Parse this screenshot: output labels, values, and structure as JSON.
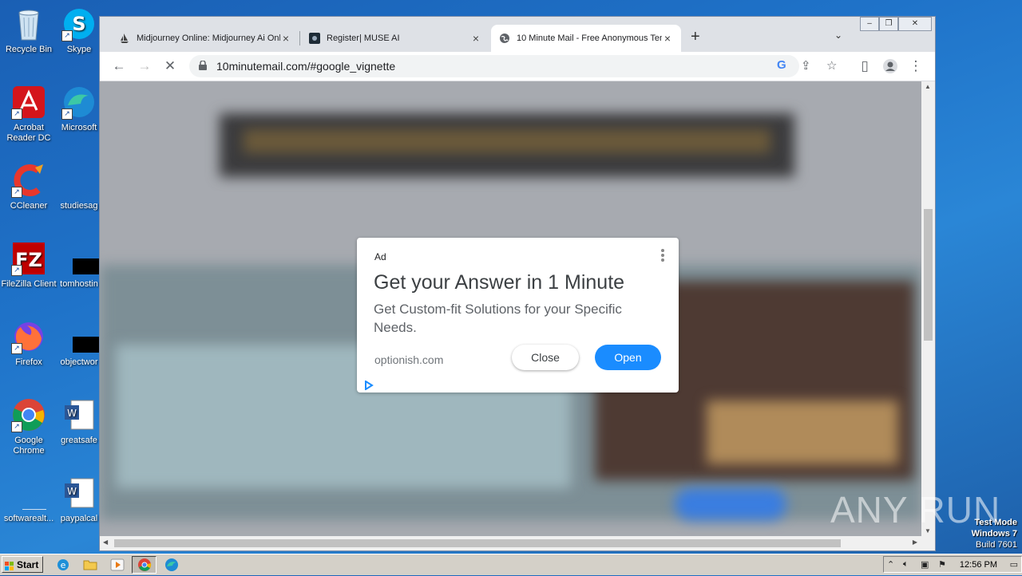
{
  "desktop": {
    "icons": [
      {
        "label": "Recycle Bin"
      },
      {
        "label": "Skype"
      },
      {
        "label": "Acrobat Reader DC"
      },
      {
        "label": "Microsoft"
      },
      {
        "label": "CCleaner"
      },
      {
        "label": "studiesag"
      },
      {
        "label": "FileZilla Client"
      },
      {
        "label": "tomhostin"
      },
      {
        "label": "Firefox"
      },
      {
        "label": "objectwor"
      },
      {
        "label": "Google Chrome"
      },
      {
        "label": "greatsafe"
      },
      {
        "label": "softwarealt..."
      },
      {
        "label": "paypalcal"
      }
    ]
  },
  "browser": {
    "tabs": [
      {
        "title": "Midjourney Online: Midjourney Ai Onl",
        "icon": "sailboat-icon"
      },
      {
        "title": "Register| MUSE AI",
        "icon": "muse-icon"
      },
      {
        "title": "10 Minute Mail - Free Anonymous Ten",
        "icon": "globe-icon"
      }
    ],
    "new_tab": "+",
    "url": "10minutemail.com/#google_vignette"
  },
  "ad": {
    "label": "Ad",
    "headline": "Get your Answer in 1 Minute",
    "description": "Get Custom-fit Solutions for your Specific Needs.",
    "domain": "optionish.com",
    "close_label": "Close",
    "open_label": "Open",
    "open_color": "#1a8cff"
  },
  "watermark": {
    "text": "ANY RUN"
  },
  "system": {
    "test_mode": "Test Mode",
    "os": "Windows 7",
    "build": "Build 7601",
    "clock": "12:56 PM"
  },
  "taskbar": {
    "start_label": "Start"
  }
}
